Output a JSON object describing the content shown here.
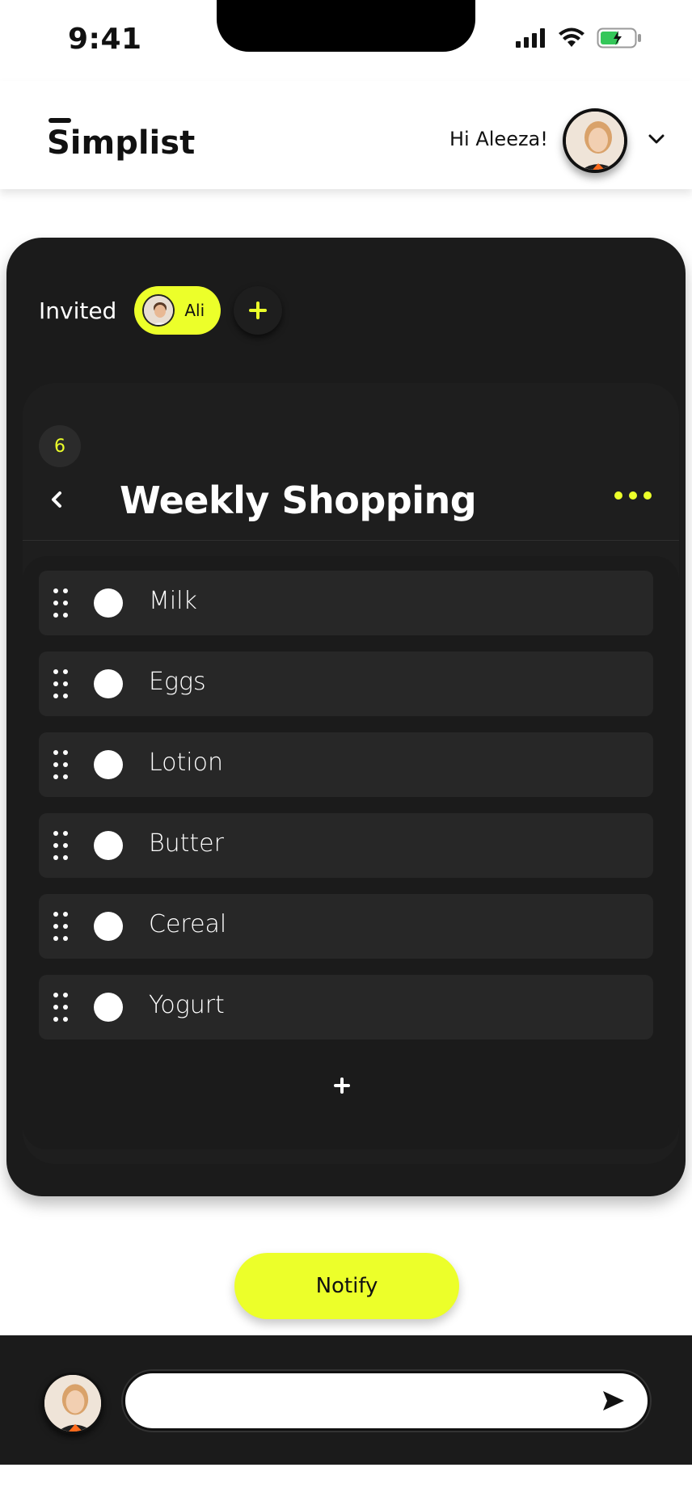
{
  "status_bar": {
    "time": "9:41",
    "icons": [
      "signal-icon",
      "wifi-icon",
      "battery-charging-icon"
    ]
  },
  "header": {
    "logo": "Simplist",
    "greeting": "Hi Aleeza!",
    "avatar_icon": "user-avatar",
    "menu_icon": "chevron-down-icon"
  },
  "invited": {
    "label": "Invited",
    "members": [
      {
        "name": "Ali"
      }
    ],
    "add_icon": "plus-icon"
  },
  "list": {
    "count": "6",
    "title": "Weekly Shopping",
    "back_icon": "chevron-left-icon",
    "more_icon": "more-horizontal-icon",
    "items": [
      {
        "label": "Milk"
      },
      {
        "label": "Eggs"
      },
      {
        "label": "Lotion"
      },
      {
        "label": "Butter"
      },
      {
        "label": "Cereal"
      },
      {
        "label": "Yogurt"
      }
    ],
    "add_item_icon": "plus-icon"
  },
  "notify": {
    "label": "Notify"
  },
  "composer": {
    "placeholder": "",
    "send_icon": "send-icon"
  },
  "colors": {
    "accent": "#ECFF2A",
    "card": "#1B1B1B",
    "row": "#272727",
    "background": "#FFFFFF"
  }
}
